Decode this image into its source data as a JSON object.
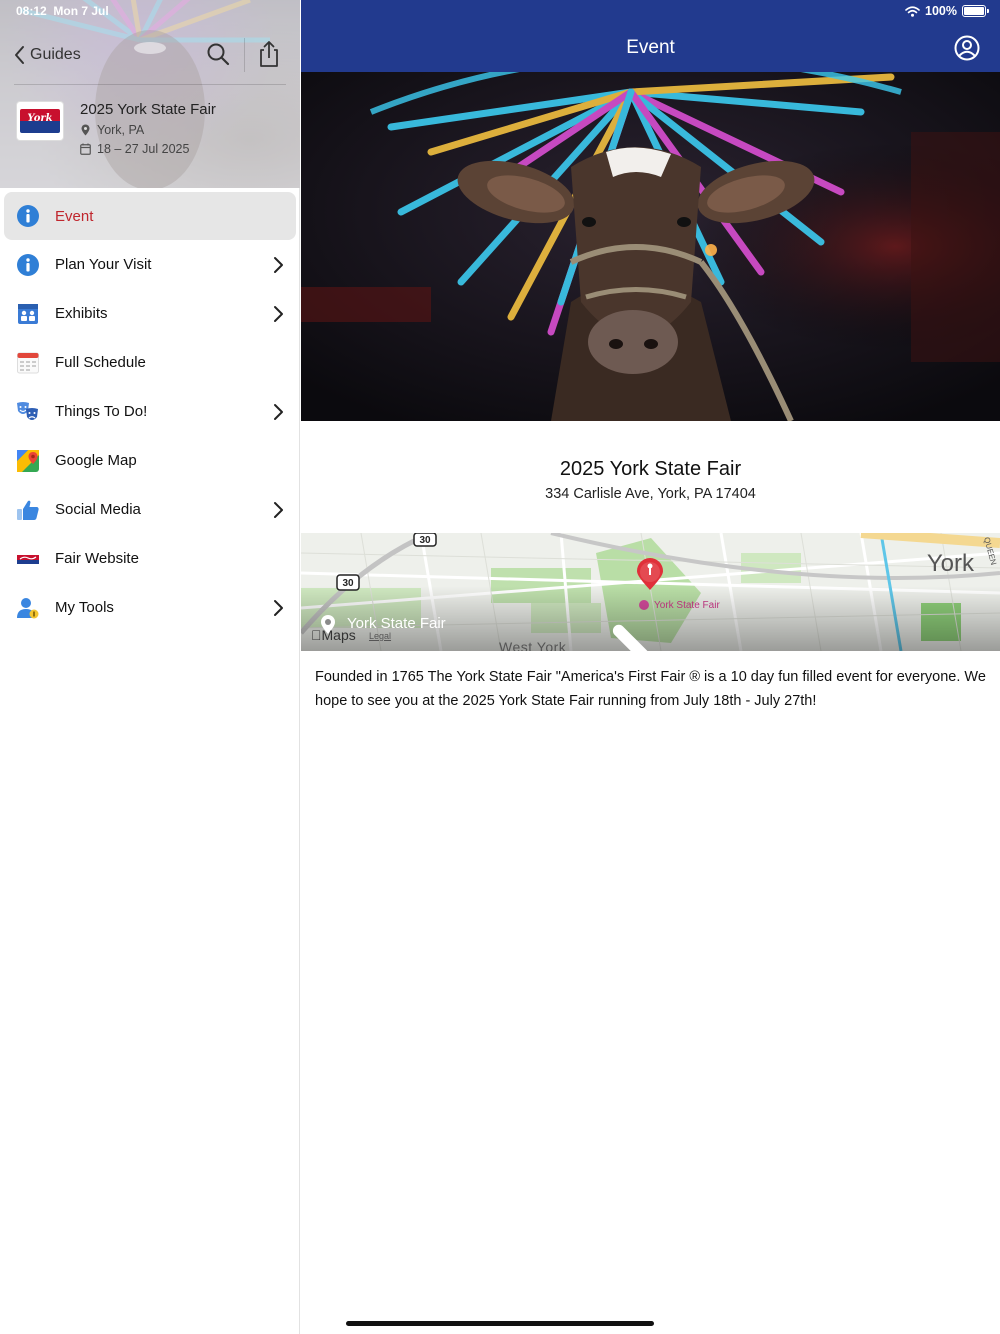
{
  "status_bar": {
    "time": "08:12",
    "date": "Mon 7 Jul",
    "battery": "100%"
  },
  "sidebar": {
    "back_label": "Guides",
    "guide": {
      "logo_text": "York",
      "title": "2025 York State Fair",
      "location": "York, PA",
      "dates": "18 – 27 Jul 2025"
    },
    "items": [
      {
        "label": "Event",
        "icon": "info-icon",
        "active": true,
        "chevron": false
      },
      {
        "label": "Plan Your Visit",
        "icon": "info-icon",
        "active": false,
        "chevron": true
      },
      {
        "label": "Exhibits",
        "icon": "exhibits-icon",
        "active": false,
        "chevron": true
      },
      {
        "label": "Full Schedule",
        "icon": "calendar-icon",
        "active": false,
        "chevron": false
      },
      {
        "label": "Things To Do!",
        "icon": "theater-masks-icon",
        "active": false,
        "chevron": true
      },
      {
        "label": "Google Map",
        "icon": "google-maps-icon",
        "active": false,
        "chevron": false
      },
      {
        "label": "Social Media",
        "icon": "thumbs-up-icon",
        "active": false,
        "chevron": true
      },
      {
        "label": "Fair Website",
        "icon": "fair-logo-icon",
        "active": false,
        "chevron": false
      },
      {
        "label": "My Tools",
        "icon": "user-tools-icon",
        "active": false,
        "chevron": true
      }
    ]
  },
  "navbar": {
    "title": "Event"
  },
  "event": {
    "title": "2025 York State Fair",
    "address": "334 Carlisle Ave, York, PA 17404"
  },
  "map": {
    "city_label": "York",
    "poi_label": "York State Fair",
    "place_label": "York State Fair",
    "brand": "Maps",
    "legal": "Legal",
    "area_label": "West York",
    "route_shields": [
      "30",
      "30"
    ],
    "street_label": "QUEEN"
  },
  "description": {
    "text_1": "Founded in 1765 The York State Fair \"America's First Fair ® is a 10 day fun filled event for everyone. We hope to see you at the 2025 York State Fair running ",
    "link_text": "from July 18th - July 27th",
    "text_2": "!"
  },
  "colors": {
    "nav_blue": "#223a8e",
    "active_red": "#c0262d",
    "info_blue": "#2f7fd6",
    "pin_red": "#e0303a"
  }
}
